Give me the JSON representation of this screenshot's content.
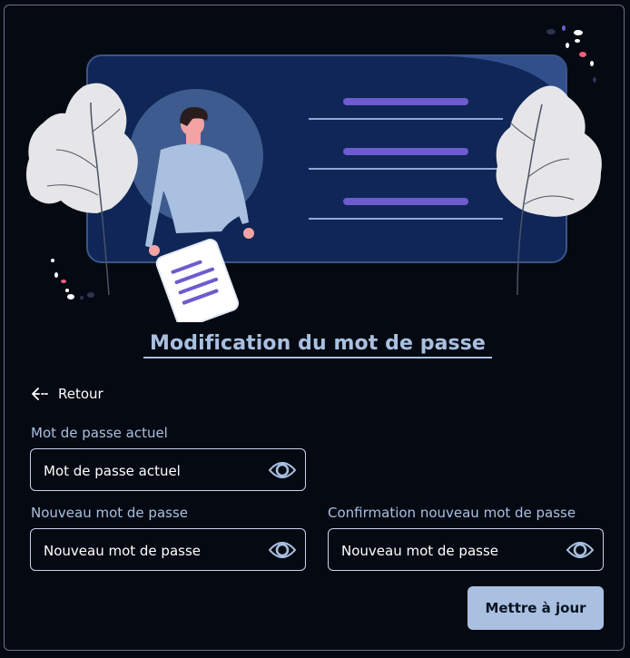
{
  "page": {
    "title": "Modification du mot de passe",
    "back_label": "Retour",
    "submit_label": "Mettre à jour"
  },
  "fields": {
    "current": {
      "label": "Mot de passe actuel",
      "placeholder": "Mot de passe actuel"
    },
    "new": {
      "label": "Nouveau mot de passe",
      "placeholder": "Nouveau mot de passe"
    },
    "confirm": {
      "label": "Confirmation nouveau mot de passe",
      "placeholder": "Nouveau mot de passe"
    }
  },
  "icons": {
    "back": "arrow-left-icon",
    "toggle_visibility": "eye-icon"
  },
  "colors": {
    "background": "#050912",
    "accent": "#a9c0e0",
    "card": "#0f2657",
    "highlight": "#6c5ccf"
  }
}
